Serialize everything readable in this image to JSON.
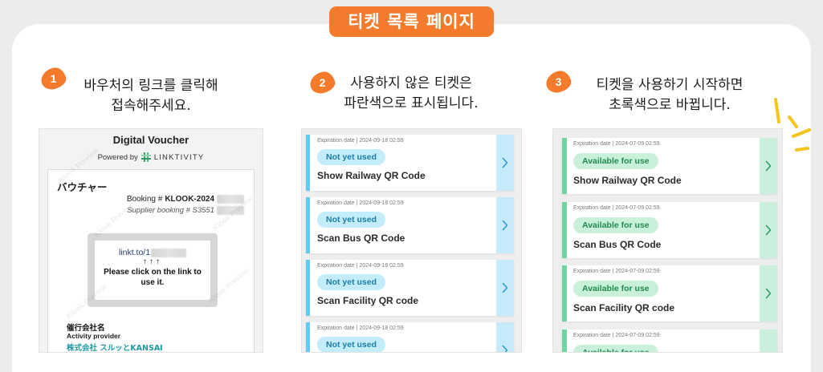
{
  "colors": {
    "accent": "#f47b2c",
    "unused_bar": "#63cbf3",
    "unused_strip": "#c7ebfa",
    "unused_chevron": "#2a9bd4",
    "unused_pill_bg": "#c3edfb",
    "unused_pill_text": "#1d7ea8",
    "available_bar": "#72d49e",
    "available_strip": "#caefdc",
    "available_chevron": "#2f9e62",
    "available_pill_bg": "#c9f1d9",
    "available_pill_text": "#208a50",
    "operator_text": "#1d9aa1",
    "link_text": "#233a78",
    "sparkle": "#f6c51b"
  },
  "icons": {
    "chevron": "chevron-right-icon",
    "brand_logo": "linktivity-logo-icon",
    "sparkles": "sparkle-lines-icon"
  },
  "page": {
    "title": "티켓 목록 페이지"
  },
  "steps": [
    {
      "number": "1",
      "line1": "바우처의 링크를 클릭해",
      "line2": "접속해주세요."
    },
    {
      "number": "2",
      "line1": "사용하지 않은 티켓은",
      "line2": "파란색으로 표시됩니다."
    },
    {
      "number": "3",
      "line1": "티켓을 사용하기 시작하면",
      "line2": "초록색으로 바뀝니다."
    }
  ],
  "voucher": {
    "title": "Digital Voucher",
    "powered_by": "Powered by",
    "brand": "LINKTIVITY",
    "heading": "バウチャー",
    "booking_label": "Booking #",
    "booking_value": "KLOOK-2024",
    "supplier_booking": "Supplier booking # S3551",
    "link": "linkt.to/1",
    "arrows": "↑↑↑",
    "instruction": "Please click on the link to use it.",
    "operator_label": "催行会社名",
    "operator_label_en": "Activity provider",
    "operator_name": "株式会社 スルッとKANSAI",
    "watermark": "Klook Preview"
  },
  "unused_list": {
    "tickets": [
      {
        "expiration": "Expiration date | 2024-09-18 02:59",
        "status": "Not yet used",
        "title": "Show Railway QR Code"
      },
      {
        "expiration": "Expiration date | 2024-09-18 02:59",
        "status": "Not yet used",
        "title": "Scan Bus QR Code"
      },
      {
        "expiration": "Expiration date | 2024-09-18 02:59",
        "status": "Not yet used",
        "title": "Scan Facility QR code"
      },
      {
        "expiration": "Expiration date | 2024-09-18 02:59",
        "status": "Not yet used"
      }
    ]
  },
  "available_list": {
    "tickets": [
      {
        "expiration": "Expiration date | 2024-07-09 02:59",
        "status": "Available for use",
        "title": "Show Railway QR Code"
      },
      {
        "expiration": "Expiration date | 2024-07-09 02:59",
        "status": "Available for use",
        "title": "Scan Bus QR Code"
      },
      {
        "expiration": "Expiration date | 2024-07-09 02:59",
        "status": "Available for use",
        "title": "Scan Facility QR code"
      },
      {
        "expiration": "Expiration date | 2024-07-09 02:59",
        "status": "Available for use"
      }
    ]
  }
}
